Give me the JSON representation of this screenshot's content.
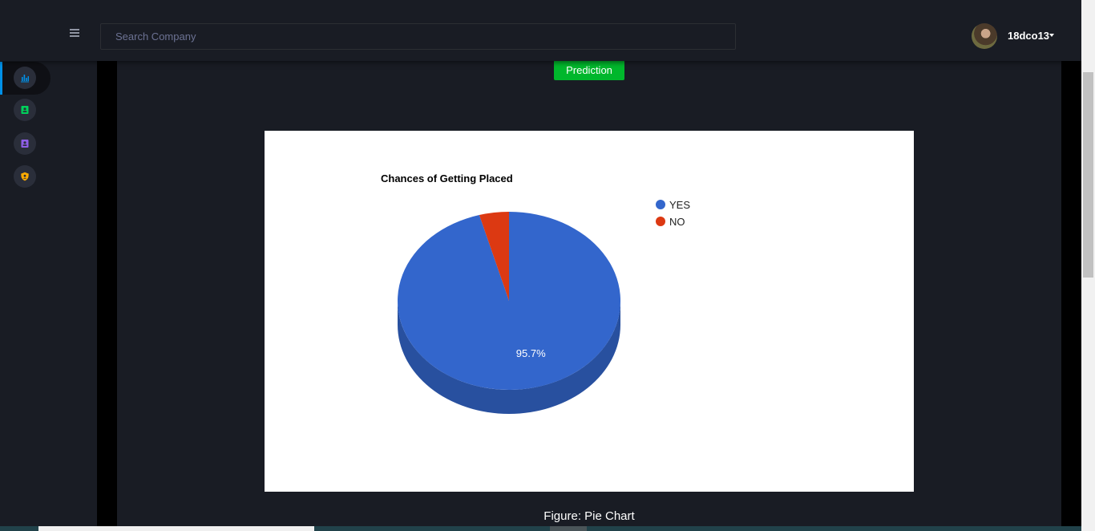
{
  "header": {
    "search_placeholder": "Search Company",
    "username": "18dco13"
  },
  "main": {
    "prediction_label": "Prediction",
    "figure_caption": "Figure: Pie Chart"
  },
  "colors": {
    "background": "#191c24",
    "accent_active": "#0090e7",
    "button_green": "#00b72c",
    "yes_slice": "#3366cc",
    "no_slice": "#dc3912"
  },
  "sidebar": {
    "items": [
      {
        "icon": "bar-chart-icon",
        "color": "#0090e7",
        "active": true
      },
      {
        "icon": "contact-card-icon",
        "color": "#00d25b",
        "active": false
      },
      {
        "icon": "contact-card-icon",
        "color": "#8f5fe8",
        "active": false
      },
      {
        "icon": "shield-icon",
        "color": "#ffab00",
        "active": false
      }
    ]
  },
  "chart_data": {
    "type": "pie",
    "title": "Chances of Getting Placed",
    "style": "3d",
    "labels": [
      "YES",
      "NO"
    ],
    "values": [
      95.7,
      4.3
    ],
    "colors": [
      "#3366cc",
      "#dc3912"
    ],
    "data_labels": [
      "95.7%",
      ""
    ],
    "legend": "right"
  }
}
